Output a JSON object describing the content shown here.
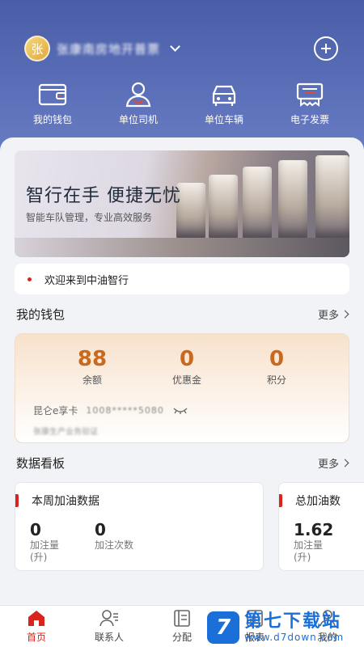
{
  "header": {
    "avatar_char": "张",
    "user_name": "张康南房地开普票",
    "quick_actions": [
      {
        "label": "我的钱包",
        "icon": "wallet-icon"
      },
      {
        "label": "单位司机",
        "icon": "driver-icon"
      },
      {
        "label": "单位车辆",
        "icon": "car-icon"
      },
      {
        "label": "电子发票",
        "icon": "invoice-icon"
      }
    ]
  },
  "banner": {
    "title": "智行在手 便捷无忧",
    "subtitle": "智能车队管理，专业高效服务"
  },
  "notice": {
    "text": "欢迎来到中油智行"
  },
  "wallet": {
    "title": "我的钱包",
    "more": "更多",
    "stats": [
      {
        "value": "88",
        "label": "余额"
      },
      {
        "value": "0",
        "label": "优惠金"
      },
      {
        "value": "0",
        "label": "积分"
      }
    ],
    "card_name": "昆仑e享卡",
    "card_number": "1008*****5080",
    "card_sub": "张康生产业务验证"
  },
  "dashboard": {
    "title": "数据看板",
    "more": "更多",
    "cards": [
      {
        "title": "本周加油数据",
        "metrics": [
          {
            "value": "0",
            "label": "加注量",
            "unit": "(升)"
          },
          {
            "value": "0",
            "label": "加注次数",
            "unit": ""
          }
        ]
      },
      {
        "title": "总加油数",
        "metrics": [
          {
            "value": "1.62",
            "label": "加注量",
            "unit": "(升)"
          }
        ]
      }
    ]
  },
  "tabbar": [
    {
      "label": "首页",
      "icon": "home-icon",
      "active": true
    },
    {
      "label": "联系人",
      "icon": "contacts-icon",
      "active": false
    },
    {
      "label": "分配",
      "icon": "assign-icon",
      "active": false
    },
    {
      "label": "报表",
      "icon": "report-icon",
      "active": false
    },
    {
      "label": "我的",
      "icon": "profile-icon",
      "active": false
    }
  ],
  "watermark": {
    "brand": "第七下载站",
    "url": "www.d7down.com",
    "logo_char": "7"
  },
  "colors": {
    "header_blue": "#4a5ea8",
    "accent_red": "#d8241c",
    "wallet_orange": "#c8691e"
  }
}
